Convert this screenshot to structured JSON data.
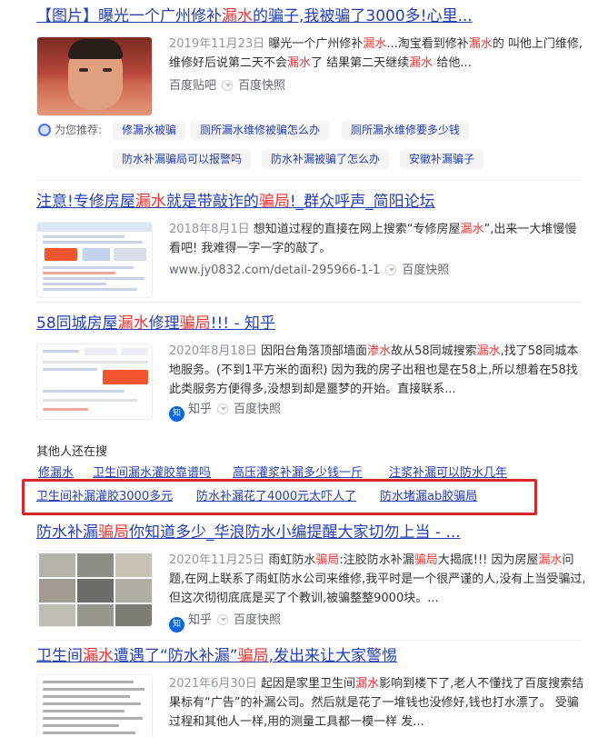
{
  "results": [
    {
      "title_parts": [
        "【图片】曝光一个广州修补",
        "漏水",
        "的骗子,我被骗了3000多!心里..."
      ],
      "date": "2019年11月23日",
      "snippet_parts": [
        "曝光一个广州修补",
        "漏水",
        "...淘宝看到修补",
        "漏水",
        "的 叫他上门维修,维修好后说第二天不会",
        "漏水",
        "了 结果第二天继续",
        "漏水",
        " 给他..."
      ],
      "source": "百度贴吧",
      "snapshot": "百度快照"
    },
    {
      "title_parts": [
        "注意!专修房屋",
        "漏水",
        "就是带敲诈的",
        "骗局",
        "!_群众呼声_简阳论坛"
      ],
      "date": "2018年8月1日",
      "snippet_parts": [
        "想知道过程的直接在网上搜索“专修房屋",
        "漏水",
        "”,出来一大堆慢慢看吧! 我难得一字一字的敲了。"
      ],
      "source": "www.jy0832.com/detail-295966-1-1",
      "snapshot": "百度快照"
    },
    {
      "title_parts": [
        "58同城房屋",
        "漏水",
        "修理",
        "骗局",
        "!!! - 知乎"
      ],
      "date": "2020年8月18日",
      "snippet_parts": [
        "因阳台角落顶部墙面",
        "渗水",
        "故从58同城搜索",
        "漏水",
        ",找了58同城本地服务。(不到1平方米的面积) 因为我的房子出租也是在58上,所以想着在58找此类服务方便得多,没想到却是噩梦的开始。直接联系..."
      ],
      "source": "知乎",
      "snapshot": "百度快照"
    },
    {
      "title_parts": [
        "防水补漏",
        "骗局",
        "你知道多少_华浪防水小编提醒大家切勿上当 - ..."
      ],
      "date": "2020年11月25日",
      "snippet_parts": [
        "雨虹防水",
        "骗局",
        ":注胶防水补漏",
        "骗局",
        "大揭底!!! 因为房屋",
        "漏水",
        "问题,在网上联系了雨虹防水公司来维修,我平时是一个很严谨的人,没有上当受骗过,但这次彻彻底底是买了个教训,被骗整整9000块。..."
      ],
      "source": "知乎",
      "snapshot": "百度快照"
    },
    {
      "title_parts": [
        "卫生间",
        "漏水",
        "遭遇了“防水补漏”",
        "骗局",
        ",发出来让大家警惕"
      ],
      "date": "2021年6月30日",
      "snippet_parts": [
        "起因是家里卫生间",
        "漏水",
        "影响到楼下了,老人不懂找了百度搜索结果标有“广告”的补漏公司。然后就是花了一堆钱也没修好,钱也打水漂了。 受骗过程和其他人一样,用的测量工具都一模一样 发..."
      ]
    }
  ],
  "recommend": {
    "label": "为您推荐:",
    "tags_row1": [
      "修漏水被骗",
      "厕所漏水维修被骗怎么办",
      "厕所漏水维修要多少钱"
    ],
    "tags_row2": [
      "防水补漏骗局可以报警吗",
      "防水补漏被骗了怎么办",
      "安徽补漏骗子"
    ]
  },
  "others": {
    "title": "其他人还在搜",
    "row1": [
      "修漏水",
      "卫生间漏水灌胶靠谱吗",
      "高压灌浆补漏多少钱一斤",
      "注浆补漏可以防水几年"
    ],
    "row2": [
      "卫生间补漏灌胶3000多元",
      "防水补漏花了4000元太吓人了",
      "防水堵漏ab胶骗局"
    ]
  },
  "zhihu_badge": "知",
  "colors": {
    "link": "#2440b3",
    "highlight": "#f73131",
    "annotation_box": "#d9262b"
  }
}
